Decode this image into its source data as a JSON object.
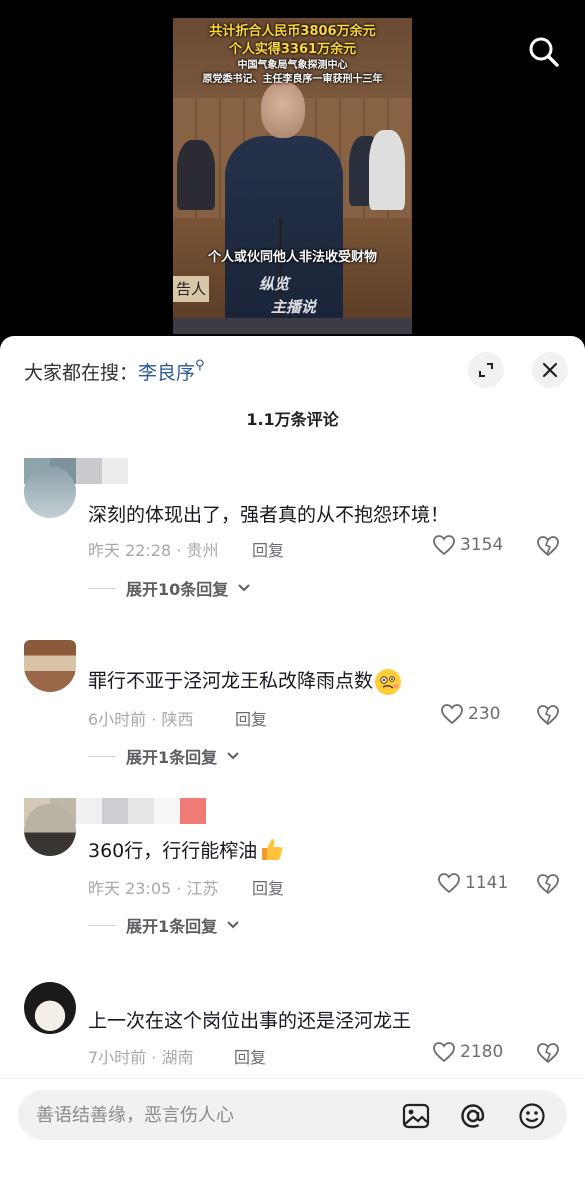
{
  "video": {
    "overlay_line1": "共计折合人民币3806万余元",
    "overlay_line2": "个人实得3361万余元",
    "overlay_line3": "中国气象局气象探测中心",
    "overlay_line4": "原党委书记、主任李良序一审获刑十三年",
    "caption": "个人或伙同他人非法收受财物",
    "court_label": "告人",
    "watermark_line1": "纵览",
    "watermark_line2": "主播说"
  },
  "sheet": {
    "hot_search_label": "大家都在搜：",
    "hot_search_term": "李良序",
    "comment_count_title": "1.1万条评论"
  },
  "comments": [
    {
      "text": "深刻的体现出了，强者真的从不抱怨环境！",
      "meta": "昨天 22:28 · 贵州",
      "reply_label": "回复",
      "likes": "3154",
      "expand_label": "展开10条回复"
    },
    {
      "text": "罪行不亚于泾河龙王私改降雨点数",
      "emoji": "woozy-face",
      "meta": "6小时前 · 陕西",
      "reply_label": "回复",
      "likes": "230",
      "expand_label": "展开1条回复"
    },
    {
      "text": "360行，行行能榨油",
      "emoji": "thumbs-up",
      "meta": "昨天 23:05 · 江苏",
      "reply_label": "回复",
      "likes": "1141",
      "expand_label": "展开1条回复"
    },
    {
      "text": "上一次在这个岗位出事的还是泾河龙王",
      "meta": "7小时前 · 湖南",
      "reply_label": "回复",
      "likes": "2180"
    }
  ],
  "input": {
    "placeholder": "善语结善缘，恶言伤人心"
  },
  "icons": {
    "search": "search-icon",
    "collapse": "collapse-icon",
    "close": "close-icon",
    "like": "heart-icon",
    "dislike": "broken-heart-icon",
    "expand_chevron": "chevron-down-icon",
    "image": "image-icon",
    "mention": "at-icon",
    "emoji": "emoji-icon"
  },
  "colors": {
    "overlay_yellow": "#ffd83a",
    "hot_search_blue": "#2a5a9a",
    "meta_gray": "#a6a8ad"
  }
}
